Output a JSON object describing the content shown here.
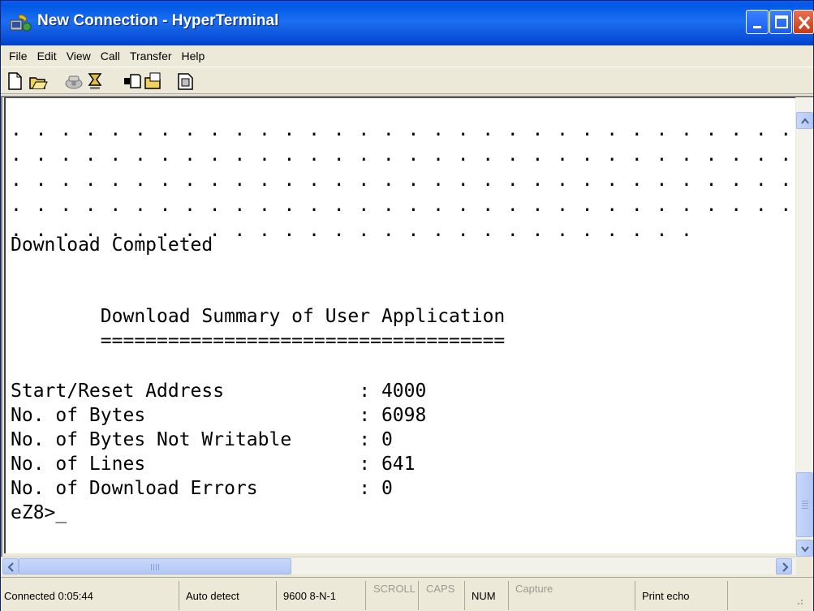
{
  "window": {
    "title": "New Connection - HyperTerminal",
    "icon": "hyperterminal-app-icon"
  },
  "menu": [
    "File",
    "Edit",
    "View",
    "Call",
    "Transfer",
    "Help"
  ],
  "toolbar": {
    "icons": [
      "new-icon",
      "open-icon",
      "call-icon",
      "disconnect-icon",
      "send-icon",
      "receive-icon",
      "properties-icon"
    ]
  },
  "terminal": {
    "lines": [
      ". . . . . . . . . . . . . . . . . . . . . . . . . . . . . . . . . . . . . . . . . . . . . . . . . . . . . . . . . . . . . . . . . . . . . . . . . . . . . . . . . . .",
      ". . . . . . . . . . . . . . . . . . . . . . . . . . . . . . . . . . . . . . . . . . . . . . . . . . . . . . . . . . . . . . . . . . . . . . . . . . . . . . . . . . .",
      ". . . . . . . . . . . . . . . . . . . . . . . . . . . . . . . . . . . . . . . . . . . . . . . . . . . . . . . . . . . . . . . . . . . . . . . . . . . . . . . . . . .",
      ". . . . . . . . . . . . . . . . . . . . . . . . . . . . . . . . . . . . . . . . . . . . . . . . . . . . . . . . . . . . . . . . . . . . . . . . . . . . . . . . . . .",
      ". . . . . . . . . . . . . . . . . . . . . . . . . . . .",
      "Download Completed",
      "",
      "",
      "        Download Summary of User Application",
      "        ====================================",
      "",
      "Start/Reset Address            : 4000",
      "No. of Bytes                   : 6098",
      "No. of Bytes Not Writable      : 0",
      "No. of Lines                   : 641",
      "No. of Download Errors         : 0",
      "eZ8>_"
    ]
  },
  "statusbar": {
    "connected": "Connected 0:05:44",
    "detect": "Auto detect",
    "settings": "9600 8-N-1",
    "scroll": "SCROLL",
    "caps": "CAPS",
    "num": "NUM",
    "capture": "Capture",
    "print_echo": "Print echo"
  },
  "scrollbars": {
    "vertical_position": 0.93,
    "horizontal_position": 0.0
  }
}
